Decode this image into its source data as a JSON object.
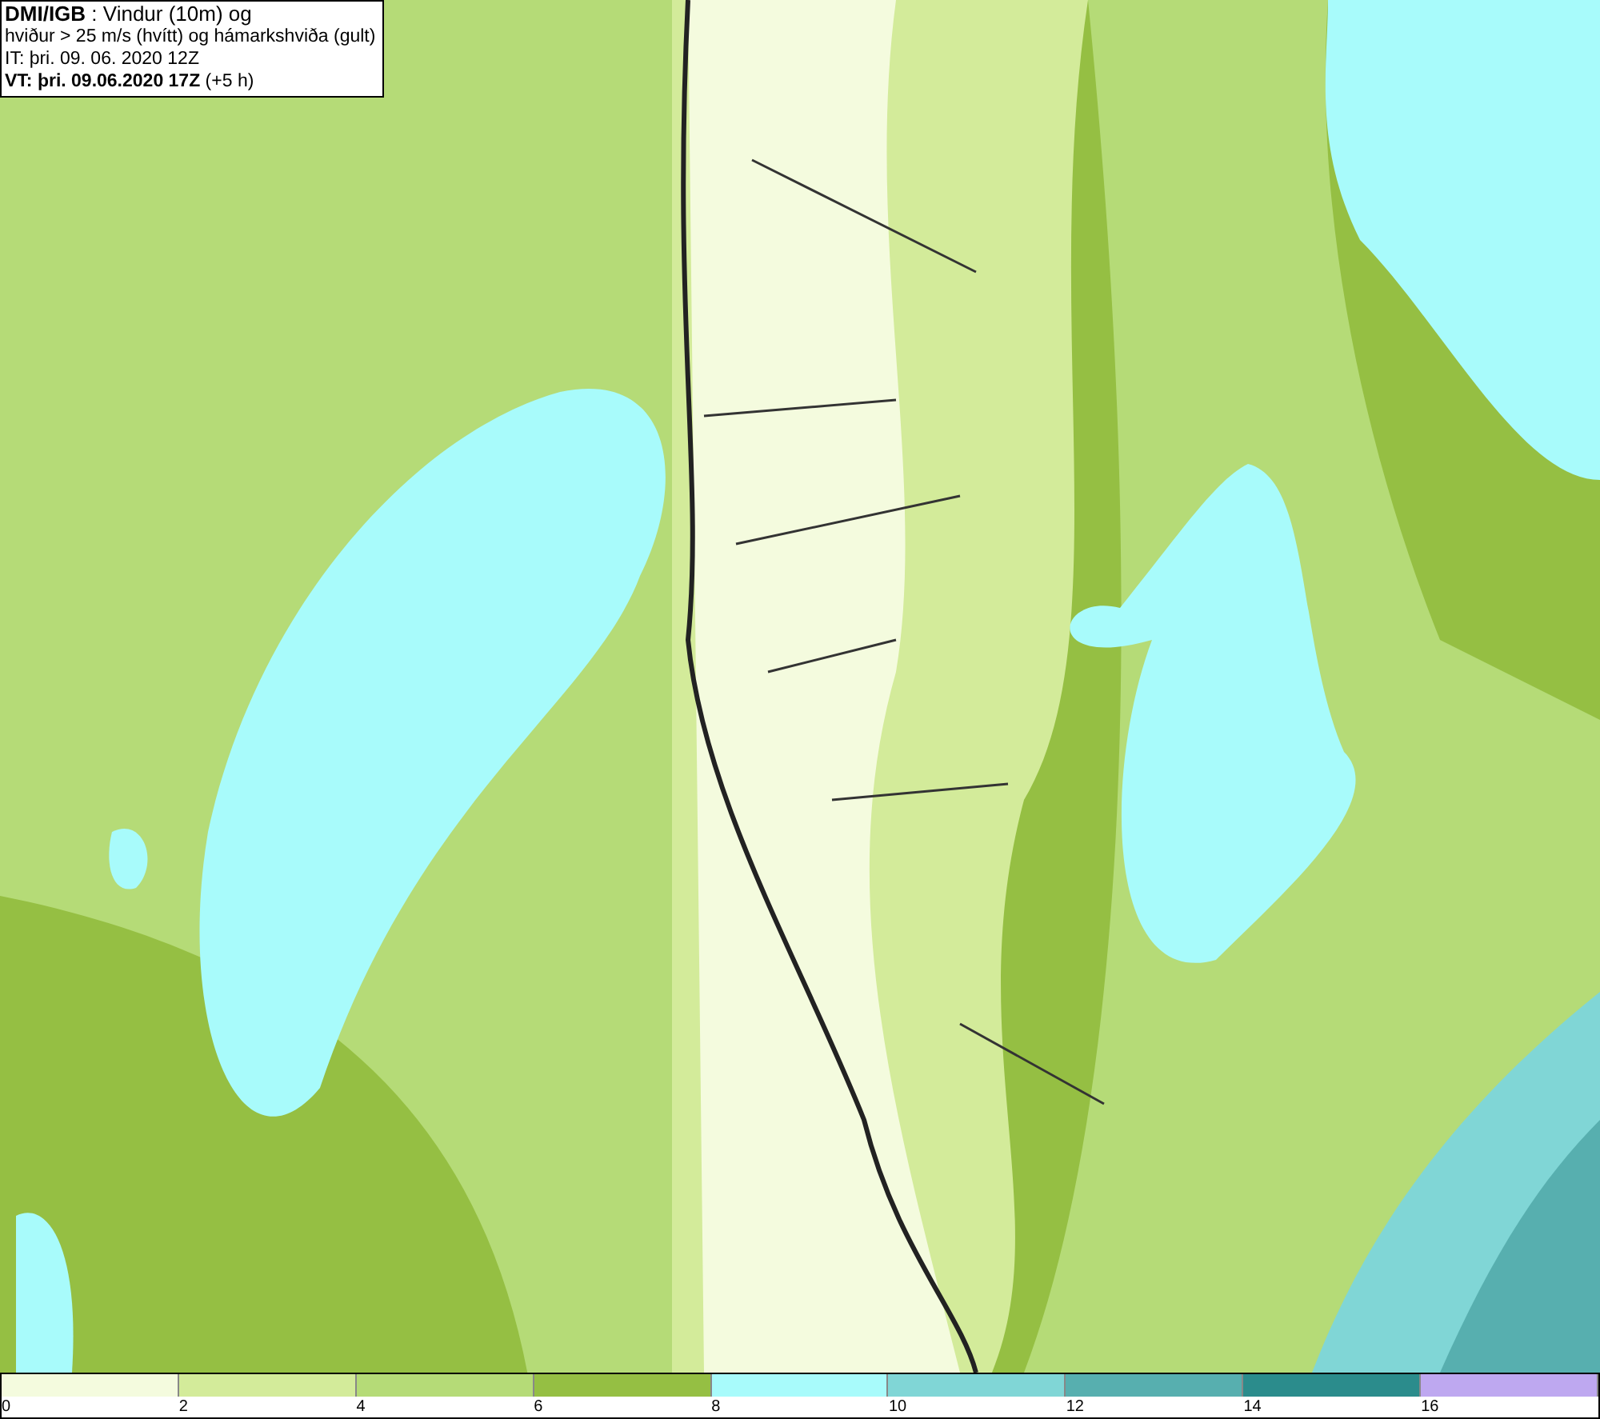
{
  "header": {
    "lines": [
      "**DMI/IGB** : Vindur (10m) og",
      "hviður > 25 m/s (hvítt) og hámarkshviða (gult)",
      "IT: þri. 09. 06. 2020 12Z",
      "**VT: þri. 09.06.2020 17Z** (+5 h)"
    ]
  },
  "legend": {
    "bins": [
      {
        "color": "#f4fbde"
      },
      {
        "color": "#d3eb9a"
      },
      {
        "color": "#b5db77"
      },
      {
        "color": "#95bf43"
      },
      {
        "color": "#a8fbfb"
      },
      {
        "color": "#80d6d6"
      },
      {
        "color": "#57afaf"
      },
      {
        "color": "#2b8c8c"
      },
      {
        "color": "#bea8f0"
      }
    ],
    "ticks": [
      "0",
      "2",
      "4",
      "6",
      "8",
      "10",
      "12",
      "14",
      "16"
    ]
  }
}
